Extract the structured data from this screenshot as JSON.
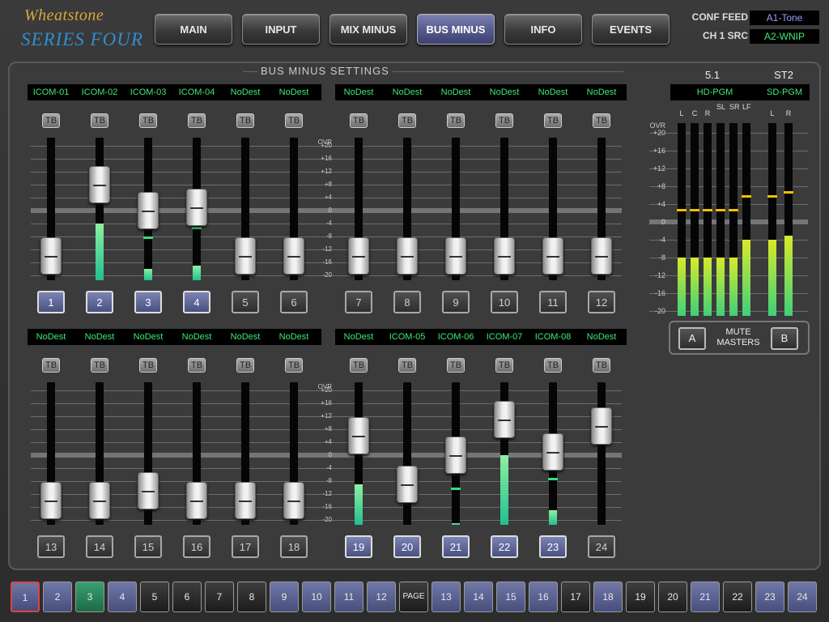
{
  "logo": {
    "brand": "Wheatstone",
    "series": "SERIES FOUR"
  },
  "nav": [
    {
      "label": "MAIN",
      "active": false
    },
    {
      "label": "INPUT",
      "active": false
    },
    {
      "label": "MIX MINUS",
      "active": false
    },
    {
      "label": "BUS MINUS",
      "active": true
    },
    {
      "label": "INFO",
      "active": false
    },
    {
      "label": "EVENTS",
      "active": false
    }
  ],
  "conf_feed": {
    "label": "CONF FEED",
    "value": "A1-Tone",
    "color": "#9c9cff"
  },
  "ch1_src": {
    "label": "CH 1 SRC",
    "value": "A2-WNIP",
    "color": "#3eea74"
  },
  "panel_title": "BUS MINUS SETTINGS",
  "tb_label": "TB",
  "scale_labels": [
    "OVR",
    "+20",
    "+16",
    "+12",
    "+8",
    "+4",
    "0",
    "-4",
    "-8",
    "-12",
    "-16",
    "-20"
  ],
  "channels_top": [
    {
      "num": "1",
      "dest": "ICOM-01",
      "fader": -14,
      "meter": null,
      "peak": null,
      "on": true
    },
    {
      "num": "2",
      "dest": "ICOM-02",
      "fader": 8,
      "meter": -4,
      "peak": 4,
      "on": true
    },
    {
      "num": "3",
      "dest": "ICOM-03",
      "fader": 0,
      "meter": -18,
      "peak": -8,
      "on": true
    },
    {
      "num": "4",
      "dest": "ICOM-04",
      "fader": 1,
      "meter": -17,
      "peak": -5,
      "on": true
    },
    {
      "num": "5",
      "dest": "NoDest",
      "fader": -14,
      "meter": null,
      "peak": null,
      "on": false
    },
    {
      "num": "6",
      "dest": "NoDest",
      "fader": -14,
      "meter": null,
      "peak": null,
      "on": false
    },
    {
      "num": "7",
      "dest": "NoDest",
      "fader": -14,
      "meter": null,
      "peak": null,
      "on": false
    },
    {
      "num": "8",
      "dest": "NoDest",
      "fader": -14,
      "meter": null,
      "peak": null,
      "on": false
    },
    {
      "num": "9",
      "dest": "NoDest",
      "fader": -14,
      "meter": null,
      "peak": null,
      "on": false
    },
    {
      "num": "10",
      "dest": "NoDest",
      "fader": -14,
      "meter": null,
      "peak": null,
      "on": false
    },
    {
      "num": "11",
      "dest": "NoDest",
      "fader": -14,
      "meter": null,
      "peak": null,
      "on": false
    },
    {
      "num": "12",
      "dest": "NoDest",
      "fader": -14,
      "meter": null,
      "peak": null,
      "on": false
    }
  ],
  "channels_bottom": [
    {
      "num": "13",
      "dest": "NoDest",
      "fader": -14,
      "meter": null,
      "peak": null,
      "on": false
    },
    {
      "num": "14",
      "dest": "NoDest",
      "fader": -14,
      "meter": null,
      "peak": null,
      "on": false
    },
    {
      "num": "15",
      "dest": "NoDest",
      "fader": -11,
      "meter": null,
      "peak": null,
      "on": false
    },
    {
      "num": "16",
      "dest": "NoDest",
      "fader": -14,
      "meter": null,
      "peak": null,
      "on": false
    },
    {
      "num": "17",
      "dest": "NoDest",
      "fader": -14,
      "meter": null,
      "peak": null,
      "on": false
    },
    {
      "num": "18",
      "dest": "NoDest",
      "fader": -14,
      "meter": null,
      "peak": null,
      "on": false
    },
    {
      "num": "19",
      "dest": "NoDest",
      "fader": 6,
      "meter": -9,
      "peak": 2,
      "on": true
    },
    {
      "num": "20",
      "dest": "ICOM-05",
      "fader": -9,
      "meter": null,
      "peak": null,
      "on": true
    },
    {
      "num": "21",
      "dest": "ICOM-06",
      "fader": 0,
      "meter": -21,
      "peak": -10,
      "on": true
    },
    {
      "num": "22",
      "dest": "ICOM-07",
      "fader": 11,
      "meter": 0,
      "peak": 10,
      "on": true
    },
    {
      "num": "23",
      "dest": "ICOM-08",
      "fader": 1,
      "meter": -17,
      "peak": -7,
      "on": true
    },
    {
      "num": "24",
      "dest": "NoDest",
      "fader": 9,
      "meter": null,
      "peak": null,
      "on": false
    }
  ],
  "masters": {
    "group1_title": "5.1",
    "group1_dest": "HD-PGM",
    "group2_title": "ST2",
    "group2_dest": "SD-PGM",
    "scale_labels": [
      "OVR",
      "+20",
      "+16",
      "+12",
      "+8",
      "+4",
      "0",
      "-4",
      "-8",
      "-12",
      "-16",
      "-20"
    ],
    "meters": [
      {
        "label": "L",
        "level": -8,
        "peak": 3
      },
      {
        "label": "C",
        "level": -8,
        "peak": 3
      },
      {
        "label": "R",
        "level": -8,
        "peak": 3
      },
      {
        "label": "SL",
        "level": -8,
        "peak": 3
      },
      {
        "label": "SR",
        "level": -8,
        "peak": 3
      },
      {
        "label": "LF",
        "level": -4,
        "peak": 6
      },
      {
        "label": "L",
        "level": -4,
        "peak": 6
      },
      {
        "label": "R",
        "level": -3,
        "peak": 7
      }
    ],
    "mute_a": "A",
    "mute_b": "B",
    "mute_label": "MUTE MASTERS"
  },
  "pages": [
    {
      "label": "1",
      "style": "sel"
    },
    {
      "label": "2",
      "style": "blue"
    },
    {
      "label": "3",
      "style": "green"
    },
    {
      "label": "4",
      "style": "blue"
    },
    {
      "label": "5",
      "style": "dark"
    },
    {
      "label": "6",
      "style": "dark"
    },
    {
      "label": "7",
      "style": "dark"
    },
    {
      "label": "8",
      "style": "dark"
    },
    {
      "label": "9",
      "style": "blue"
    },
    {
      "label": "10",
      "style": "blue"
    },
    {
      "label": "11",
      "style": "blue"
    },
    {
      "label": "12",
      "style": "blue"
    },
    {
      "label": "PAGE",
      "style": "page"
    },
    {
      "label": "13",
      "style": "blue"
    },
    {
      "label": "14",
      "style": "blue"
    },
    {
      "label": "15",
      "style": "blue"
    },
    {
      "label": "16",
      "style": "blue"
    },
    {
      "label": "17",
      "style": "dark"
    },
    {
      "label": "18",
      "style": "blue"
    },
    {
      "label": "19",
      "style": "dark"
    },
    {
      "label": "20",
      "style": "dark"
    },
    {
      "label": "21",
      "style": "blue"
    },
    {
      "label": "22",
      "style": "dark"
    },
    {
      "label": "23",
      "style": "blue"
    },
    {
      "label": "24",
      "style": "blue"
    }
  ],
  "colors": {
    "accent_green": "#3eea74",
    "peak_yellow": "#f0c000",
    "peak_green": "#30e080"
  }
}
